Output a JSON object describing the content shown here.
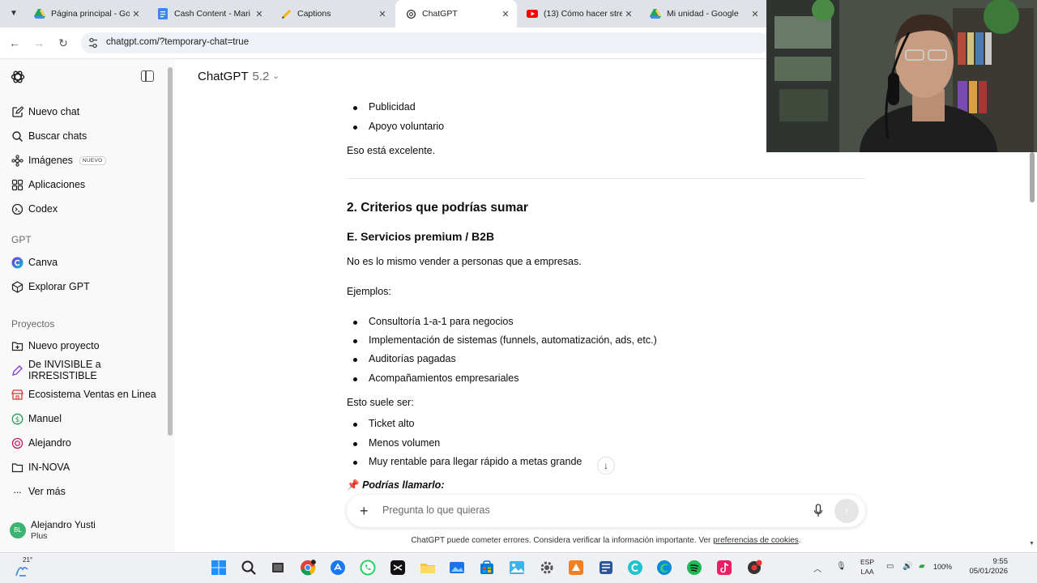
{
  "browser": {
    "tabs": [
      {
        "title": "Página principal - Go",
        "icon": "google-drive-icon"
      },
      {
        "title": "Cash Content - Mari",
        "icon": "google-docs-icon"
      },
      {
        "title": "Captions",
        "icon": "pencil-icon"
      },
      {
        "title": "ChatGPT",
        "icon": "chatgpt-icon",
        "active": true
      },
      {
        "title": "(13) Cómo hacer stre",
        "icon": "youtube-icon"
      },
      {
        "title": "Mi unidad - Google",
        "icon": "google-drive-icon"
      }
    ],
    "url": "chatgpt.com/?temporary-chat=true"
  },
  "sidebar": {
    "top_items": [
      {
        "label": "Nuevo chat",
        "icon": "new-chat-icon"
      },
      {
        "label": "Buscar chats",
        "icon": "search-icon"
      },
      {
        "label": "Imágenes",
        "icon": "image-icon",
        "badge": "NUEVO"
      },
      {
        "label": "Aplicaciones",
        "icon": "apps-icon"
      },
      {
        "label": "Codex",
        "icon": "codex-icon"
      }
    ],
    "gpt_section": "GPT",
    "gpt_items": [
      {
        "label": "Canva",
        "icon": "canva-icon"
      },
      {
        "label": "Explorar GPT",
        "icon": "explore-gpt-icon"
      }
    ],
    "projects_section": "Proyectos",
    "project_items": [
      {
        "label": "Nuevo proyecto",
        "icon": "new-folder-icon"
      },
      {
        "label": "De INVISIBLE a IRRESISTIBLE",
        "icon": "pen-icon"
      },
      {
        "label": "Ecosistema Ventas en Linea",
        "icon": "shop-icon"
      },
      {
        "label": "Manuel",
        "icon": "dollar-icon"
      },
      {
        "label": "Alejandro",
        "icon": "ring-icon"
      },
      {
        "label": "IN-NOVA",
        "icon": "folder-icon"
      },
      {
        "label": "Ver más",
        "icon": "more-icon"
      }
    ],
    "user": {
      "name": "Alejandro Yusti",
      "plan": "Plus",
      "initials": "BL"
    }
  },
  "header": {
    "model_name": "ChatGPT",
    "model_version": "5.2"
  },
  "conversation": {
    "bullets_top": [
      "Publicidad",
      "Apoyo voluntario"
    ],
    "paragraph_1": "Eso está excelente.",
    "heading_2": "2. Criterios que podrías sumar",
    "heading_3": "E. Servicios premium / B2B",
    "paragraph_2": "No es lo mismo vender a personas que a empresas.",
    "examples_label": "Ejemplos:",
    "examples": [
      "Consultoría 1-a-1 para negocios",
      "Implementación de sistemas (funnels, automatización, ads, etc.)",
      "Auditorías pagadas",
      "Acompañamientos empresariales"
    ],
    "usually_label": "Esto suele ser:",
    "usually": [
      "Ticket alto",
      "Menos volumen",
      "Muy rentable para llegar rápido a metas grande"
    ],
    "callout": "Podrías llamarlo:"
  },
  "composer": {
    "placeholder": "Pregunta lo que quieras"
  },
  "footer": {
    "disclaimer": "ChatGPT puede cometer errores. Considera verificar la información importante. Ver",
    "link": "preferencias de cookies",
    "end": "."
  },
  "taskbar": {
    "temperature": "21°",
    "language_top": "ESP",
    "language_bottom": "LAA",
    "battery": "100%",
    "time": "9:55",
    "date": "05/01/2026"
  },
  "colors": {
    "accent_avatar": "#3cb371",
    "youtube_red": "#ff0000"
  }
}
